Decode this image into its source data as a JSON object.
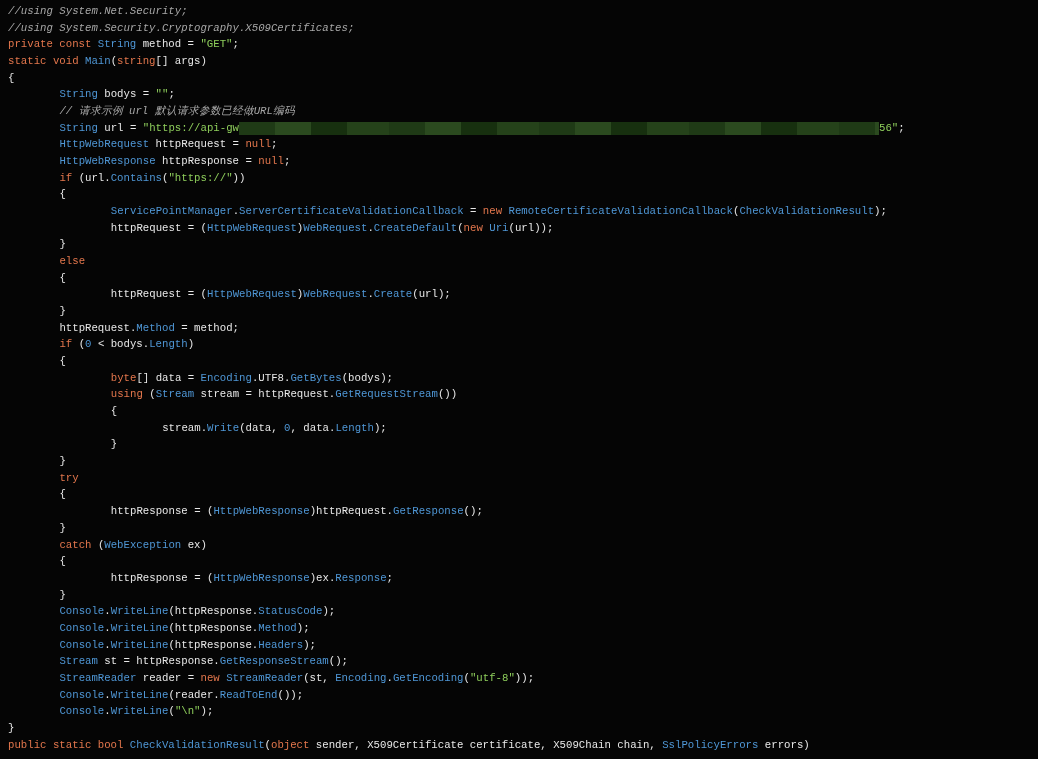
{
  "code_lines": [
    {
      "tokens": [
        {
          "text": "//using System.Net.Security;",
          "kind": "comment"
        }
      ]
    },
    {
      "tokens": [
        {
          "text": "//using System.Security.Cryptography.X509Certificates;",
          "kind": "comment"
        }
      ]
    },
    {
      "tokens": [
        {
          "text": "private const ",
          "kind": "keyword"
        },
        {
          "text": "String",
          "kind": "type"
        },
        {
          "text": " method = ",
          "kind": "plain"
        },
        {
          "text": "\"GET\"",
          "kind": "string"
        },
        {
          "text": ";",
          "kind": "plain"
        }
      ]
    },
    {
      "tokens": [
        {
          "text": "static void ",
          "kind": "keyword"
        },
        {
          "text": "Main",
          "kind": "type"
        },
        {
          "text": "(",
          "kind": "plain"
        },
        {
          "text": "string",
          "kind": "keyword"
        },
        {
          "text": "[] args)",
          "kind": "plain"
        }
      ]
    },
    {
      "tokens": [
        {
          "text": "{",
          "kind": "plain"
        }
      ],
      "children": [
        {
          "tokens": [
            {
              "text": "String",
              "kind": "type"
            },
            {
              "text": " bodys = ",
              "kind": "plain"
            },
            {
              "text": "\"\"",
              "kind": "string"
            },
            {
              "text": ";",
              "kind": "plain"
            }
          ]
        },
        {
          "tokens": [
            {
              "text": "// 请求示例 url 默认请求参数已经做URL编码",
              "kind": "comment"
            }
          ]
        },
        {
          "tokens": [
            {
              "text": "String",
              "kind": "type"
            },
            {
              "text": " url = ",
              "kind": "plain"
            },
            {
              "text": "\"https://api-gw",
              "kind": "string"
            },
            {
              "kind": "mosaic"
            },
            {
              "text": "56\"",
              "kind": "string"
            },
            {
              "text": ";",
              "kind": "plain"
            }
          ]
        },
        {
          "tokens": [
            {
              "text": "HttpWebRequest",
              "kind": "type"
            },
            {
              "text": " httpRequest = ",
              "kind": "plain"
            },
            {
              "text": "null",
              "kind": "keyword"
            },
            {
              "text": ";",
              "kind": "plain"
            }
          ]
        },
        {
          "tokens": [
            {
              "text": "HttpWebResponse",
              "kind": "type"
            },
            {
              "text": " httpResponse = ",
              "kind": "plain"
            },
            {
              "text": "null",
              "kind": "keyword"
            },
            {
              "text": ";",
              "kind": "plain"
            }
          ]
        },
        {
          "tokens": [
            {
              "text": "if",
              "kind": "keyword"
            },
            {
              "text": " (url.",
              "kind": "plain"
            },
            {
              "text": "Contains",
              "kind": "type"
            },
            {
              "text": "(",
              "kind": "plain"
            },
            {
              "text": "\"https://\"",
              "kind": "string"
            },
            {
              "text": "))",
              "kind": "plain"
            }
          ]
        },
        {
          "tokens": [
            {
              "text": "{",
              "kind": "plain"
            }
          ],
          "children": [
            {
              "tokens": [
                {
                  "text": "ServicePointManager",
                  "kind": "type"
                },
                {
                  "text": ".",
                  "kind": "plain"
                },
                {
                  "text": "ServerCertificateValidationCallback",
                  "kind": "type"
                },
                {
                  "text": " = ",
                  "kind": "plain"
                },
                {
                  "text": "new ",
                  "kind": "keyword"
                },
                {
                  "text": "RemoteCertificateValidationCallback",
                  "kind": "type"
                },
                {
                  "text": "(",
                  "kind": "plain"
                },
                {
                  "text": "CheckValidationResult",
                  "kind": "type"
                },
                {
                  "text": ");",
                  "kind": "plain"
                }
              ]
            },
            {
              "tokens": [
                {
                  "text": "httpRequest = (",
                  "kind": "plain"
                },
                {
                  "text": "HttpWebRequest",
                  "kind": "type"
                },
                {
                  "text": ")",
                  "kind": "plain"
                },
                {
                  "text": "WebRequest",
                  "kind": "type"
                },
                {
                  "text": ".",
                  "kind": "plain"
                },
                {
                  "text": "CreateDefault",
                  "kind": "type"
                },
                {
                  "text": "(",
                  "kind": "plain"
                },
                {
                  "text": "new ",
                  "kind": "keyword"
                },
                {
                  "text": "Uri",
                  "kind": "type"
                },
                {
                  "text": "(url));",
                  "kind": "plain"
                }
              ]
            }
          ]
        },
        {
          "tokens": [
            {
              "text": "}",
              "kind": "plain"
            }
          ]
        },
        {
          "tokens": [
            {
              "text": "else",
              "kind": "keyword"
            }
          ]
        },
        {
          "tokens": [
            {
              "text": "{",
              "kind": "plain"
            }
          ],
          "children": [
            {
              "tokens": [
                {
                  "text": "httpRequest = (",
                  "kind": "plain"
                },
                {
                  "text": "HttpWebRequest",
                  "kind": "type"
                },
                {
                  "text": ")",
                  "kind": "plain"
                },
                {
                  "text": "WebRequest",
                  "kind": "type"
                },
                {
                  "text": ".",
                  "kind": "plain"
                },
                {
                  "text": "Create",
                  "kind": "type"
                },
                {
                  "text": "(url);",
                  "kind": "plain"
                }
              ]
            }
          ]
        },
        {
          "tokens": [
            {
              "text": "}",
              "kind": "plain"
            }
          ]
        },
        {
          "tokens": [
            {
              "text": "httpRequest.",
              "kind": "plain"
            },
            {
              "text": "Method",
              "kind": "type"
            },
            {
              "text": " = method;",
              "kind": "plain"
            }
          ]
        },
        {
          "tokens": [
            {
              "text": "if",
              "kind": "keyword"
            },
            {
              "text": " (",
              "kind": "plain"
            },
            {
              "text": "0",
              "kind": "number"
            },
            {
              "text": " < bodys.",
              "kind": "plain"
            },
            {
              "text": "Length",
              "kind": "type"
            },
            {
              "text": ")",
              "kind": "plain"
            }
          ]
        },
        {
          "tokens": [
            {
              "text": "{",
              "kind": "plain"
            }
          ],
          "children": [
            {
              "tokens": [
                {
                  "text": "byte",
                  "kind": "keyword"
                },
                {
                  "text": "[] data = ",
                  "kind": "plain"
                },
                {
                  "text": "Encoding",
                  "kind": "type"
                },
                {
                  "text": ".UTF8.",
                  "kind": "plain"
                },
                {
                  "text": "GetBytes",
                  "kind": "type"
                },
                {
                  "text": "(bodys);",
                  "kind": "plain"
                }
              ]
            },
            {
              "tokens": [
                {
                  "text": "using",
                  "kind": "keyword"
                },
                {
                  "text": " (",
                  "kind": "plain"
                },
                {
                  "text": "Stream",
                  "kind": "type"
                },
                {
                  "text": " stream = httpRequest.",
                  "kind": "plain"
                },
                {
                  "text": "GetRequestStream",
                  "kind": "type"
                },
                {
                  "text": "())",
                  "kind": "plain"
                }
              ]
            },
            {
              "tokens": [
                {
                  "text": "{",
                  "kind": "plain"
                }
              ],
              "children": [
                {
                  "tokens": [
                    {
                      "text": "stream.",
                      "kind": "plain"
                    },
                    {
                      "text": "Write",
                      "kind": "type"
                    },
                    {
                      "text": "(data, ",
                      "kind": "plain"
                    },
                    {
                      "text": "0",
                      "kind": "number"
                    },
                    {
                      "text": ", data.",
                      "kind": "plain"
                    },
                    {
                      "text": "Length",
                      "kind": "type"
                    },
                    {
                      "text": ");",
                      "kind": "plain"
                    }
                  ]
                }
              ]
            },
            {
              "tokens": [
                {
                  "text": "}",
                  "kind": "plain"
                }
              ]
            }
          ]
        },
        {
          "tokens": [
            {
              "text": "}",
              "kind": "plain"
            }
          ]
        },
        {
          "tokens": [
            {
              "text": "try",
              "kind": "keyword"
            }
          ]
        },
        {
          "tokens": [
            {
              "text": "{",
              "kind": "plain"
            }
          ],
          "children": [
            {
              "tokens": [
                {
                  "text": "httpResponse = (",
                  "kind": "plain"
                },
                {
                  "text": "HttpWebResponse",
                  "kind": "type"
                },
                {
                  "text": ")httpRequest.",
                  "kind": "plain"
                },
                {
                  "text": "GetResponse",
                  "kind": "type"
                },
                {
                  "text": "();",
                  "kind": "plain"
                }
              ]
            }
          ]
        },
        {
          "tokens": [
            {
              "text": "}",
              "kind": "plain"
            }
          ]
        },
        {
          "tokens": [
            {
              "text": "catch",
              "kind": "keyword"
            },
            {
              "text": " (",
              "kind": "plain"
            },
            {
              "text": "WebException",
              "kind": "type"
            },
            {
              "text": " ex)",
              "kind": "plain"
            }
          ]
        },
        {
          "tokens": [
            {
              "text": "{",
              "kind": "plain"
            }
          ],
          "children": [
            {
              "tokens": [
                {
                  "text": "httpResponse = (",
                  "kind": "plain"
                },
                {
                  "text": "HttpWebResponse",
                  "kind": "type"
                },
                {
                  "text": ")ex.",
                  "kind": "plain"
                },
                {
                  "text": "Response",
                  "kind": "type"
                },
                {
                  "text": ";",
                  "kind": "plain"
                }
              ]
            }
          ]
        },
        {
          "tokens": [
            {
              "text": "}",
              "kind": "plain"
            }
          ]
        },
        {
          "tokens": [
            {
              "text": "Console",
              "kind": "type"
            },
            {
              "text": ".",
              "kind": "plain"
            },
            {
              "text": "WriteLine",
              "kind": "type"
            },
            {
              "text": "(httpResponse.",
              "kind": "plain"
            },
            {
              "text": "StatusCode",
              "kind": "type"
            },
            {
              "text": ");",
              "kind": "plain"
            }
          ]
        },
        {
          "tokens": [
            {
              "text": "Console",
              "kind": "type"
            },
            {
              "text": ".",
              "kind": "plain"
            },
            {
              "text": "WriteLine",
              "kind": "type"
            },
            {
              "text": "(httpResponse.",
              "kind": "plain"
            },
            {
              "text": "Method",
              "kind": "type"
            },
            {
              "text": ");",
              "kind": "plain"
            }
          ]
        },
        {
          "tokens": [
            {
              "text": "Console",
              "kind": "type"
            },
            {
              "text": ".",
              "kind": "plain"
            },
            {
              "text": "WriteLine",
              "kind": "type"
            },
            {
              "text": "(httpResponse.",
              "kind": "plain"
            },
            {
              "text": "Headers",
              "kind": "type"
            },
            {
              "text": ");",
              "kind": "plain"
            }
          ]
        },
        {
          "tokens": [
            {
              "text": "Stream",
              "kind": "type"
            },
            {
              "text": " st = httpResponse.",
              "kind": "plain"
            },
            {
              "text": "GetResponseStream",
              "kind": "type"
            },
            {
              "text": "();",
              "kind": "plain"
            }
          ]
        },
        {
          "tokens": [
            {
              "text": "StreamReader",
              "kind": "type"
            },
            {
              "text": " reader = ",
              "kind": "plain"
            },
            {
              "text": "new ",
              "kind": "keyword"
            },
            {
              "text": "StreamReader",
              "kind": "type"
            },
            {
              "text": "(st, ",
              "kind": "plain"
            },
            {
              "text": "Encoding",
              "kind": "type"
            },
            {
              "text": ".",
              "kind": "plain"
            },
            {
              "text": "GetEncoding",
              "kind": "type"
            },
            {
              "text": "(",
              "kind": "plain"
            },
            {
              "text": "\"utf-8\"",
              "kind": "string"
            },
            {
              "text": "));",
              "kind": "plain"
            }
          ]
        },
        {
          "tokens": [
            {
              "text": "Console",
              "kind": "type"
            },
            {
              "text": ".",
              "kind": "plain"
            },
            {
              "text": "WriteLine",
              "kind": "type"
            },
            {
              "text": "(reader.",
              "kind": "plain"
            },
            {
              "text": "ReadToEnd",
              "kind": "type"
            },
            {
              "text": "());",
              "kind": "plain"
            }
          ]
        },
        {
          "tokens": [
            {
              "text": "Console",
              "kind": "type"
            },
            {
              "text": ".",
              "kind": "plain"
            },
            {
              "text": "WriteLine",
              "kind": "type"
            },
            {
              "text": "(",
              "kind": "plain"
            },
            {
              "text": "\"\\n\"",
              "kind": "string"
            },
            {
              "text": ");",
              "kind": "plain"
            }
          ]
        }
      ]
    },
    {
      "tokens": [
        {
          "text": "}",
          "kind": "plain"
        }
      ]
    },
    {
      "tokens": [
        {
          "text": "public static bool ",
          "kind": "keyword"
        },
        {
          "text": "CheckValidationResult",
          "kind": "type"
        },
        {
          "text": "(",
          "kind": "plain"
        },
        {
          "text": "object",
          "kind": "keyword"
        },
        {
          "text": " sender, X509Certificate certificate, X509Chain chain, ",
          "kind": "plain"
        },
        {
          "text": "SslPolicyErrors",
          "kind": "type"
        },
        {
          "text": " errors)",
          "kind": "plain"
        }
      ]
    }
  ]
}
